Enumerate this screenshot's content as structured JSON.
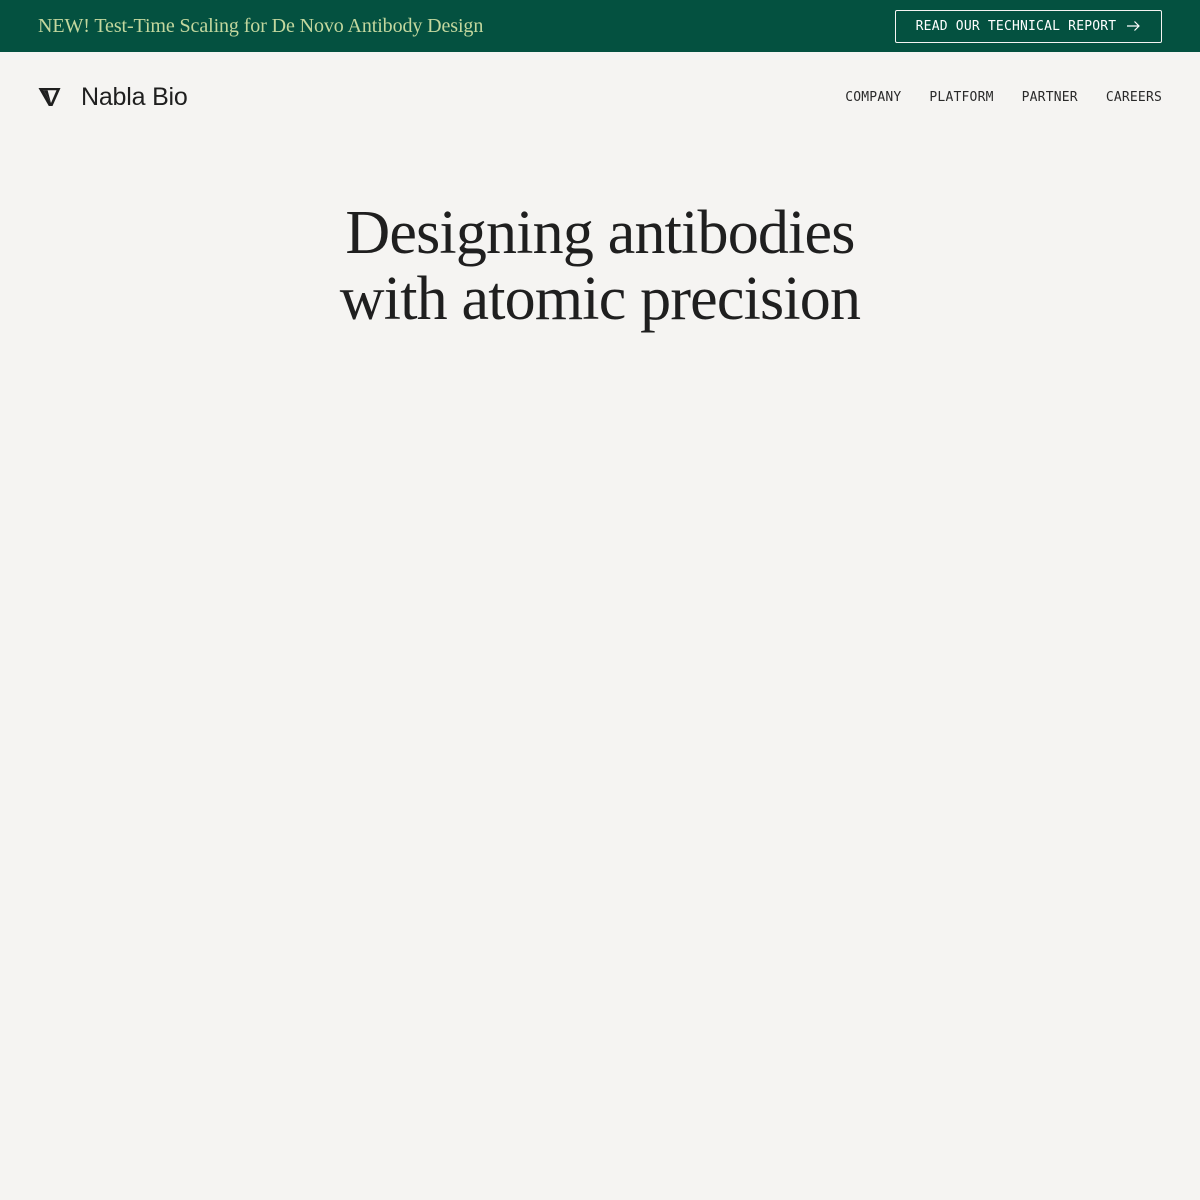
{
  "announcement": {
    "text": "NEW! Test-Time Scaling for De Novo Antibody Design",
    "button_label": "READ OUR TECHNICAL REPORT",
    "button_icon": "arrow-right-icon"
  },
  "brand": {
    "name": "Nabla Bio",
    "logo_icon": "nabla-logo-icon"
  },
  "nav": {
    "links": [
      {
        "label": "COMPANY"
      },
      {
        "label": "PLATFORM"
      },
      {
        "label": "PARTNER"
      },
      {
        "label": "CAREERS"
      }
    ]
  },
  "hero": {
    "title_line1": "Designing antibodies",
    "title_line2": "with atomic precision"
  },
  "colors": {
    "banner_bg": "#045140",
    "banner_text": "#c3d79e",
    "page_bg": "#f5f4f2",
    "text_dark": "#1f1f1f"
  }
}
